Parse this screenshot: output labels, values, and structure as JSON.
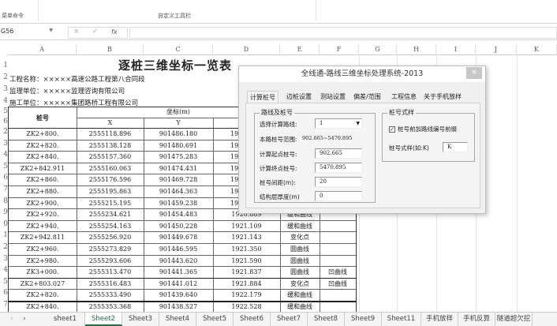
{
  "ribbon": {
    "groups": [
      "菜单命令",
      "自定义工具栏"
    ]
  },
  "formula_bar": {
    "name_box": "G56",
    "cancel_icon": "×",
    "enter_icon": "✓",
    "fx_label": "fx",
    "value": ""
  },
  "columns": [
    "A",
    "B",
    "C",
    "D",
    "E",
    "F",
    "G",
    "H",
    "I",
    "J",
    "K"
  ],
  "sheet": {
    "title": "逐桩三维坐标一览表",
    "info": [
      "工程名称：×××××高速公路工程第八合同段",
      "监理单位：×××××监理咨询有限公司",
      "施工单位：×××××集团路桥工程有限公司"
    ],
    "row_numbers_top": [
      "1",
      "2",
      "3",
      "4",
      "5",
      "6"
    ],
    "header_station": "桩号",
    "header_coord": "坐标(m)",
    "header_x": "X",
    "header_y": "Y",
    "row_numbers": [
      "2",
      "3",
      "4",
      "5",
      "6",
      "7",
      "8",
      "9",
      "0",
      "1",
      "2",
      "3",
      "4",
      "5",
      "6",
      "7"
    ],
    "rows": [
      [
        "ZK2+800.",
        "2555118.896",
        "901486.180",
        "19",
        "",
        ""
      ],
      [
        "ZK2+820.",
        "2555138.128",
        "901480.691",
        "19",
        "",
        ""
      ],
      [
        "ZK2+840.",
        "2555157.360",
        "901475.283",
        "19",
        "",
        ""
      ],
      [
        "ZK2+842.911",
        "2555160.063",
        "901474.431",
        "19",
        "",
        ""
      ],
      [
        "ZK2+860.",
        "2555176.596",
        "901469.728",
        "19",
        "",
        ""
      ],
      [
        "ZK2+880.",
        "2555195.863",
        "901464.363",
        "19",
        "",
        ""
      ],
      [
        "ZK2+900.",
        "2555215.195",
        "901459.238",
        "19",
        "",
        ""
      ],
      [
        "ZK2+920.",
        "2555234.621",
        "901454.483",
        "1920.889",
        "缓和曲线",
        ""
      ],
      [
        "ZK2+940.",
        "2555254.163",
        "901450.228",
        "1921.109",
        "缓和曲线",
        ""
      ],
      [
        "ZK2+942.811",
        "2555256.920",
        "901449.678",
        "1921.143",
        "变化点",
        ""
      ],
      [
        "ZK2+960.",
        "2555273.829",
        "901446.595",
        "1921.350",
        "圆曲线",
        ""
      ],
      [
        "ZK2+980.",
        "2555293.606",
        "901443.620",
        "1921.590",
        "圆曲线",
        ""
      ],
      [
        "ZK3+000.",
        "2555313.470",
        "901441.365",
        "1921.837",
        "圆曲线",
        "凹曲线"
      ],
      [
        "ZK2+803.027",
        "2555316.483",
        "901441.012",
        "1921.884",
        "变化点",
        "凹曲线"
      ],
      [
        "ZK2+820.",
        "2555333.490",
        "901439.640",
        "1922.179",
        "缓和曲线",
        ""
      ],
      [
        "ZK2+840.",
        "2555353.368",
        "901438.527",
        "1922.528",
        "缓和曲线",
        ""
      ]
    ]
  },
  "sheet_tabs": {
    "nav": [
      "‹",
      "›"
    ],
    "tabs": [
      "sheet1",
      "Sheet2",
      "Sheet3",
      "Sheet4",
      "Sheet5",
      "Sheet6",
      "Sheet7",
      "Sheet8",
      "Sheet9",
      "Sheet11",
      "手机放样",
      "手机反算",
      "隧道超欠挖"
    ],
    "active": "Sheet2",
    "accent": "#217346"
  },
  "dialog": {
    "title": "全线通-路线三维坐标处理系统-2013",
    "close": "×",
    "tabs": [
      "计算桩号",
      "边桩设置",
      "测站设置",
      "偏差/范围",
      "工程信息",
      "关于手机放样"
    ],
    "group_left": "路线及桩号",
    "route_label": "选择计算路线:",
    "route_value": "1",
    "range_label": "本路桩号范围:",
    "range_value": "902.665~5470.895",
    "start_label": "计算起点桩号:",
    "start_value": "902.665",
    "end_label": "计算终点桩号:",
    "end_value": "5470.895",
    "interval_label": "桩号间距(m):",
    "interval_value": "20",
    "thickness_label": "结构层厚度(m)",
    "thickness_value": "0",
    "group_right": "桩号式样",
    "prefix_checkbox": "桩号前加路线编号前缀",
    "prefix_checked": true,
    "style_label": "桩号式样(如:K)",
    "style_value": "K"
  }
}
